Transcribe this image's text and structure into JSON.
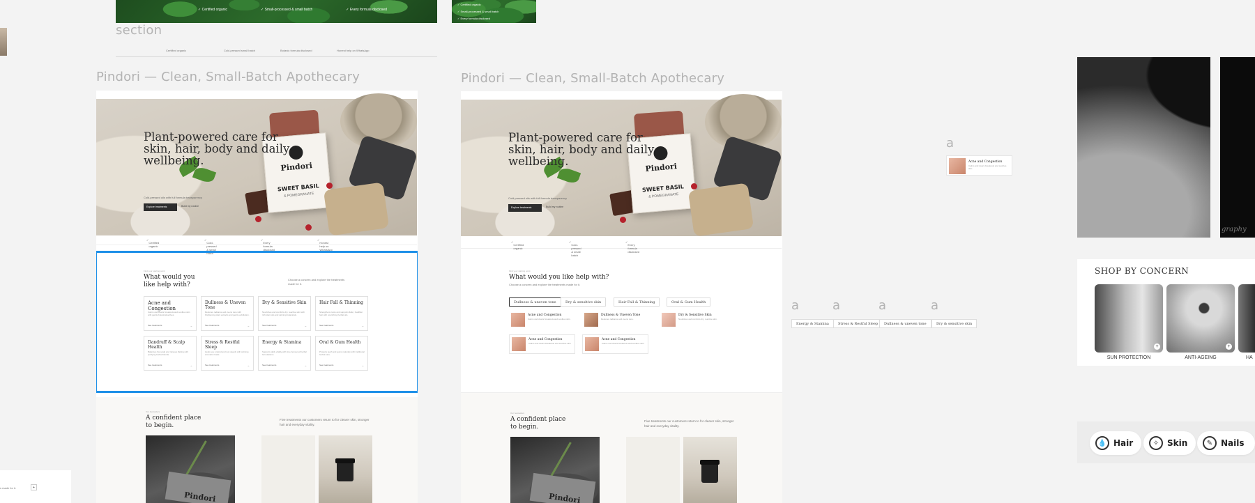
{
  "canvas": {
    "section_label": "section",
    "top_frame_features": [
      "Certified organic",
      "Small-processed & small batch",
      "Every formula disclosed"
    ],
    "top_right_features": [
      "Certified organic",
      "Small-processed & small batch",
      "Every formula disclosed"
    ],
    "top_strip_features": [
      "Certified organic",
      "Cold-pressed small batch",
      "Botanic formula disclosed",
      "Honest help on WhatsApp"
    ],
    "stray_letters": [
      "a",
      "a",
      "a",
      "a",
      "a"
    ],
    "left_edge_text": "s made for it.",
    "watermark_text": "graphy"
  },
  "frame_a": {
    "title": "Pindori — Clean, Small-Batch Apothecary",
    "hero": {
      "headline": "Plant-powered care for skin, hair, body and daily wellbeing.",
      "subtext": "Cold-pressed oils with full formula transparency",
      "primary_button": "Explore treatments",
      "secondary_button": "Build my routine",
      "product_brand": "Pindori",
      "product_variant": "SWEET BASIL",
      "product_sub": "& POMEGRANATE"
    },
    "features": [
      "Certified organic",
      "Cold-pressed & small batch",
      "Every formula disclosed",
      "Honest help on WhatsApp"
    ],
    "concern": {
      "eyebrow": "Find your starting point",
      "heading": "What would you like help with?",
      "intro": "Choose a concern and explore the treatments made for it.",
      "cards": [
        {
          "title": "Acne and Congestion",
          "desc": "Calms and clears breakouts and soothes skin with gentle botanical actives.",
          "link": "See treatments"
        },
        {
          "title": "Dullness & Uneven Tone",
          "desc": "Restores radiance and evens tone with brightening plant extracts and gentle exfoliation.",
          "link": "See treatments"
        },
        {
          "title": "Dry & Sensitive Skin",
          "desc": "Nourishes and comforts dry, reactive skin with rich plant oils and calming botanicals.",
          "link": "See treatments"
        },
        {
          "title": "Hair Fall & Thinning",
          "desc": "Strengthens roots and supports fuller, healthier hair with nourishing herbal oils.",
          "link": "See treatments"
        },
        {
          "title": "Dandruff & Scalp Health",
          "desc": "Balances the scalp and relieves flaking with purifying herbal blends.",
          "link": "See treatments"
        },
        {
          "title": "Stress & Restful Sleep",
          "desc": "Helps you unwind and rest deeply with calming aromatic rituals.",
          "link": "See treatments"
        },
        {
          "title": "Energy & Stamina",
          "desc": "Supports daily vitality with time-honoured herbal formulations.",
          "link": "See treatments"
        },
        {
          "title": "Oral & Gum Health",
          "desc": "Protects teeth and gums naturally with traditional herbal care.",
          "link": "See treatments"
        }
      ]
    },
    "confident": {
      "eyebrow": "Our bestsellers",
      "heading": "A confident place to begin.",
      "subtext": "Five treatments our customers return to for clearer skin, stronger hair and everyday vitality.",
      "product_brand": "Pindori"
    }
  },
  "frame_b": {
    "title": "Pindori — Clean, Small-Batch Apothecary",
    "hero": {
      "headline": "Plant-powered care for skin, hair, body and daily wellbeing.",
      "subtext": "Cold-pressed oils with full formula transparency",
      "primary_button": "Explore treatments",
      "secondary_button": "Build my routine",
      "product_brand": "Pindori",
      "product_variant": "SWEET BASIL",
      "product_sub": "& POMEGRANATE"
    },
    "features": [
      "Certified organic",
      "Cold-pressed & small batch",
      "Every formula disclosed"
    ],
    "concern": {
      "eyebrow": "Find your starting point",
      "heading": "What would you like help with?",
      "intro": "Choose a concern and explore the treatments made for it.",
      "tabs": [
        "Dullness & uneven tone",
        "Dry & sensitive skin",
        "Hair Fall & Thinning",
        "Oral & Gum Health"
      ],
      "items": [
        {
          "title": "Acne and Congestion",
          "desc": "Calms and clears breakouts and soothes skin."
        },
        {
          "title": "Dullness & Uneven Tone",
          "desc": "Restores radiance and evens tone."
        },
        {
          "title": "Dry & Sensitive Skin",
          "desc": "Nourishes and comforts dry, reactive skin."
        },
        {
          "title": "Acne and Congestion",
          "desc": "Calms and clears breakouts and soothes skin."
        },
        {
          "title": "Acne and Congestion",
          "desc": "Calms and clears breakouts and soothes skin."
        }
      ]
    },
    "confident": {
      "eyebrow": "Our bestsellers",
      "heading": "A confident place to begin.",
      "subtext": "Five treatments our customers return to for clearer skin, stronger hair and everyday vitality.",
      "product_brand": "Pindori"
    }
  },
  "component_card": {
    "title": "Acne and Congestion",
    "desc": "Calms and clears breakouts and soothes skin."
  },
  "component_pills": [
    "Energy & Stamina",
    "Stress & Restful Sleep",
    "Dullness & uneven tone",
    "Dry & sensitive skin"
  ],
  "shop_by_concern": {
    "heading": "SHOP BY CONCERN",
    "items": [
      "SUN PROTECTION",
      "ANTI-AGEING",
      "HA"
    ]
  },
  "category_nav": [
    {
      "label": "Hair",
      "icon": "droplet-icon"
    },
    {
      "label": "Skin",
      "icon": "sparkle-icon"
    },
    {
      "label": "Nails",
      "icon": "nail-icon"
    }
  ],
  "colors": {
    "canvas": "#f3f3f3",
    "selection": "#1e90e8",
    "primary_button": "#2d2d2d"
  }
}
